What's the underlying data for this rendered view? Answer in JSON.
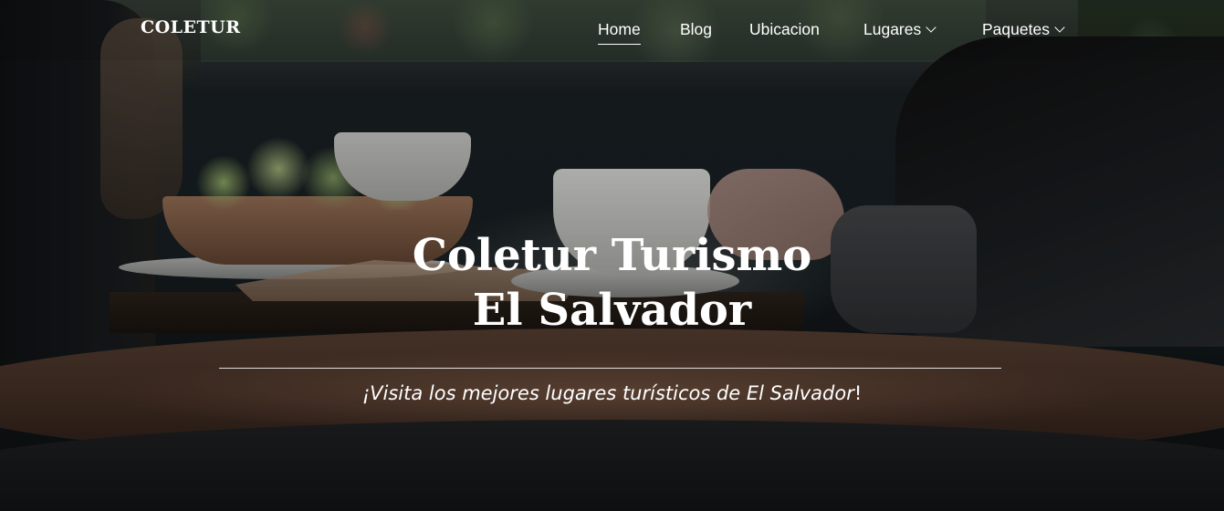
{
  "brand": "COLETUR",
  "nav": {
    "items": [
      {
        "label": "Home",
        "active": true,
        "dropdown": false
      },
      {
        "label": "Blog",
        "active": false,
        "dropdown": false
      },
      {
        "label": "Ubicacion",
        "active": false,
        "dropdown": false
      },
      {
        "label": "Lugares",
        "active": false,
        "dropdown": true
      },
      {
        "label": "Paquetes",
        "active": false,
        "dropdown": true
      }
    ]
  },
  "hero": {
    "title_line1": "Coletur Turismo",
    "title_line2": "El Salvador",
    "subtitle": "¡Visita los mejores lugares turísticos de El Salvador",
    "subtitle_end": "!"
  }
}
